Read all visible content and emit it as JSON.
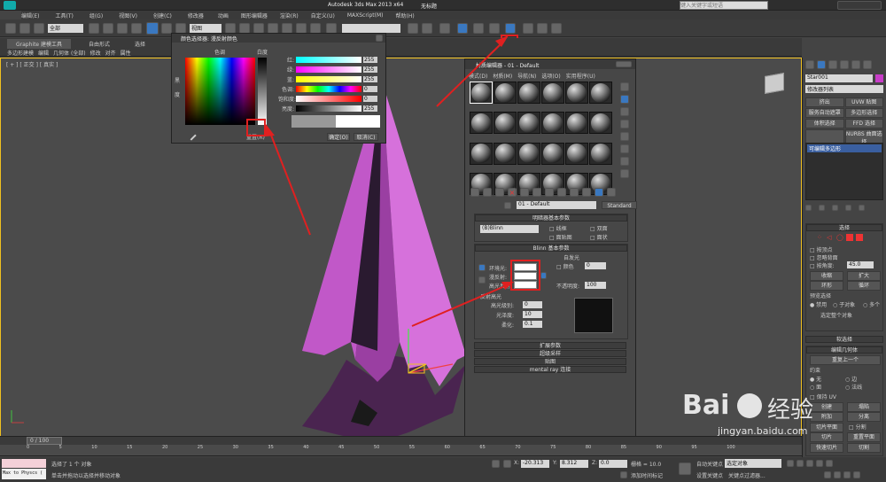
{
  "app": {
    "title": "Autodesk 3ds Max 2013 x64",
    "doc_title": "无标题",
    "search_placeholder": "键入关键字或短语"
  },
  "menu": [
    "编辑(E)",
    "工具(T)",
    "组(G)",
    "视图(V)",
    "创建(C)",
    "修改器",
    "动画",
    "图形编辑器",
    "渲染(R)",
    "自定义(U)",
    "MAXScript(M)",
    "帮助(H)"
  ],
  "toolbar": {
    "selection_filter": "全部",
    "ref_coord": "视图"
  },
  "ribbon": {
    "tabs": [
      "Graphite 建模工具",
      "自由形式",
      "选择"
    ],
    "subtabs": [
      "多边形建模",
      "编辑",
      "几何体 (全部)",
      "修改",
      "对齐",
      "属性"
    ]
  },
  "viewport": {
    "label": "[ + ] [ 正交 ] [ 真实 ]"
  },
  "color_dialog": {
    "title": "颜色选择器: 漫反射颜色",
    "hue_label": "色调",
    "white_label": "白度",
    "black_label": "黑",
    "degree_label": "度",
    "sliders": [
      {
        "label": "红:",
        "value": "255"
      },
      {
        "label": "绿:",
        "value": "255"
      },
      {
        "label": "蓝:",
        "value": "255"
      },
      {
        "label": "色调:",
        "value": "0"
      },
      {
        "label": "饱和度:",
        "value": "0"
      },
      {
        "label": "亮度:",
        "value": "255"
      }
    ],
    "reset": "重置(R)",
    "ok": "确定(O)",
    "cancel": "取消(C)"
  },
  "mat_editor": {
    "title": "材质编辑器 - 01 - Default",
    "menu": [
      "模式(D)",
      "材质(M)",
      "导航(N)",
      "选项(O)",
      "实用程序(U)"
    ],
    "material_name": "01 - Default",
    "material_type": "Standard",
    "shader_rollout": "明暗器基本参数",
    "shader": "(B)Blinn",
    "shader_opts": [
      "线框",
      "双面",
      "面贴图",
      "面状"
    ],
    "blinn_rollout": "Blinn 基本参数",
    "self_illum": "自发光",
    "color_label": "颜色",
    "self_illum_value": "0",
    "ambient": "环境光:",
    "diffuse": "漫反射:",
    "specular": "高光反射:",
    "opacity_label": "不透明度:",
    "opacity_value": "100",
    "highlights": "反射高光",
    "spec_level": "高光级别:",
    "spec_level_value": "0",
    "glossiness": "光泽度:",
    "glossiness_value": "10",
    "soften": "柔化:",
    "soften_value": "0.1",
    "rollouts": [
      "扩展参数",
      "超级采样",
      "贴图",
      "mental ray 连接"
    ]
  },
  "cmd_panel": {
    "object_name": "Star001",
    "modifier_list": "修改器列表",
    "mod_buttons": [
      "挤出",
      "UVW 贴图",
      "服务自动遮罩",
      "多边形选择",
      "体积选择",
      "FFD 选择",
      "",
      "NURBS 曲面选择"
    ],
    "stack_item": "可编辑多边形",
    "select_rollout": "选择",
    "by_vertex": "按顶点",
    "ignore_back": "忽略背面",
    "angle_label": "按角度:",
    "angle_value": "45.0",
    "shrink": "收缩",
    "grow": "扩大",
    "ring": "环形",
    "loop": "循环",
    "preview_sel": "预览选择",
    "preview_opts": [
      "禁用",
      "子对象",
      "多个"
    ],
    "select_whole": "选定整个对象",
    "soft_sel": "软选择",
    "edit_geom": "编辑几何体",
    "repeat_last": "重复上一个",
    "constraints": "约束",
    "constraint_opts": [
      "无",
      "边",
      "面",
      "法线"
    ],
    "preserve_uv": "保持 UV",
    "create": "创建",
    "collapse": "塌陷",
    "attach": "附加",
    "detach": "分离",
    "slice_plane": "切片平面",
    "split": "分割",
    "slice": "切片",
    "reset_plane": "重置平面",
    "quickslice": "快速切片",
    "cut": "切割"
  },
  "timeline": {
    "position": "0 / 100",
    "ticks": [
      "0",
      "5",
      "10",
      "15",
      "20",
      "25",
      "30",
      "35",
      "40",
      "45",
      "50",
      "55",
      "60",
      "65",
      "70",
      "75",
      "80",
      "85",
      "90",
      "95",
      "100"
    ]
  },
  "status": {
    "maxscript": "Max to Physcs (",
    "selected": "选择了 1 个 对象",
    "prompt": "单击并拖动以选择并移动对象",
    "x_label": "X:",
    "x": "-20.313",
    "y_label": "Y:",
    "y": "8.312",
    "z_label": "Z:",
    "z": "0.0",
    "grid": "栅格 = 10.0",
    "auto_key": "自动关键点",
    "set_key": "设置关键点",
    "sel_set": "选定对象",
    "key_filters": "关键点过滤器...",
    "add_tag": "添加时间标记"
  },
  "watermark": {
    "brand": "Bai",
    "brand2": "经验",
    "url": "jingyan.baidu.com"
  }
}
